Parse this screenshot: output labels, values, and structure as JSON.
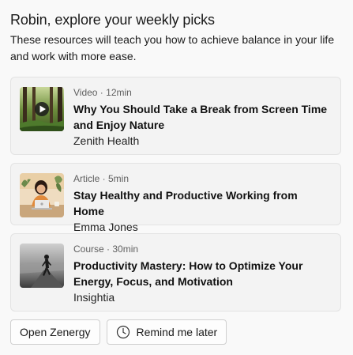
{
  "header": {
    "title": "Robin, explore your weekly picks",
    "subtitle": "These resources will teach you how to achieve balance in your life and work with more ease."
  },
  "cards": [
    {
      "meta": "Video · 12min",
      "title": "Why You Should Take a Break from Screen Time and Enjoy Nature",
      "author": "Zenith Health",
      "thumbnail": "forest-video-thumbnail"
    },
    {
      "meta": "Article · 5min",
      "title": "Stay Healthy and Productive Working from Home",
      "author": "Emma Jones",
      "thumbnail": "woman-laptop-illustration"
    },
    {
      "meta": "Course · 30min",
      "title": "Productivity Mastery: How to Optimize Your Energy, Focus, and Motivation",
      "author": "Insightia",
      "thumbnail": "runner-on-road-photo"
    }
  ],
  "actions": {
    "open_label": "Open Zenergy",
    "remind_label": "Remind me later",
    "remind_icon": "clock-icon"
  }
}
